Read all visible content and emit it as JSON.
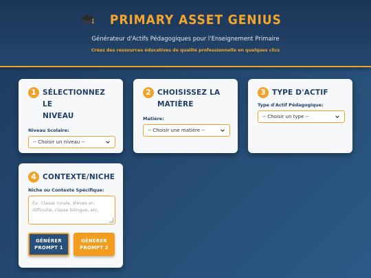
{
  "header": {
    "title": "PRIMARY ASSET GENIUS",
    "subtitle": "Générateur d'Actifs Pédagogiques pour l'Enseignement Primaire",
    "tagline": "Créez des ressources éducatives de qualité professionnelle en quelques clics",
    "icon": "graduation-cap-icon"
  },
  "cards": [
    {
      "number": "1",
      "title_line1": "SÉLECTIONNEZ LE",
      "title_line2": "NIVEAU",
      "field_label": "Niveau Scolaire:",
      "select_value": "-- Choisir un niveau --"
    },
    {
      "number": "2",
      "title_line1": "CHOISISSEZ LA",
      "title_line2": "MATIÈRE",
      "field_label": "Matière:",
      "select_value": "-- Choisir une matière --"
    },
    {
      "number": "3",
      "title_line1": "TYPE D'ACTIF",
      "field_label": "Type d'Actif Pédagogique:",
      "select_value": "-- Choisir un type --"
    },
    {
      "number": "4",
      "title_line1": "CONTEXTE/NICHE",
      "field_label": "Niche ou Contexte Spécifique:",
      "textarea_placeholder": "Ex: Classe rurale, élèves en difficulté, classe bilingue, etc."
    }
  ],
  "buttons": {
    "prompt1_line1": "GÉNÉRER",
    "prompt1_line2": "PROMPT 1",
    "prompt2_line1": "GÉNÉRER",
    "prompt2_line2": "PROMPT 2"
  },
  "colors": {
    "accent": "#f0a22a",
    "navy": "#1f3e67",
    "background": "#254a72"
  }
}
